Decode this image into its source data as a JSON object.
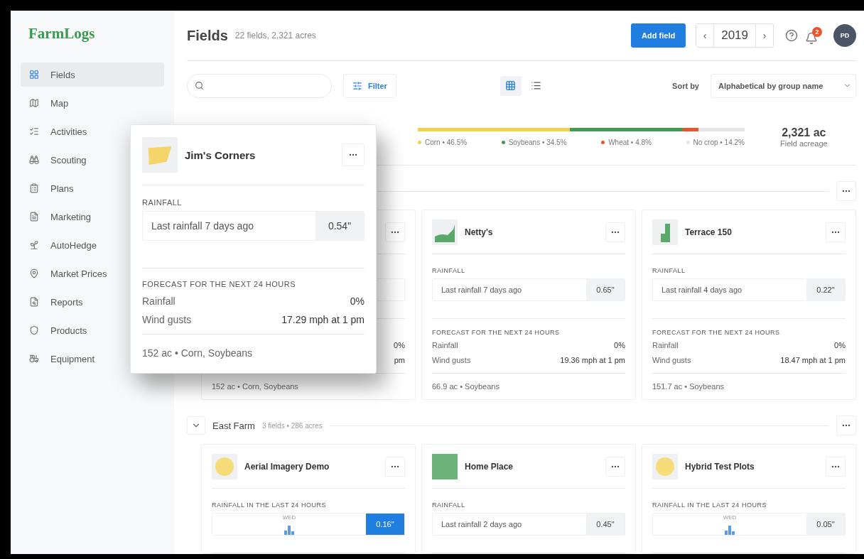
{
  "brand": "FarmLogs",
  "sidebar": {
    "items": [
      {
        "label": "Fields",
        "selected": true
      },
      {
        "label": "Map",
        "selected": false
      },
      {
        "label": "Activities",
        "selected": false
      },
      {
        "label": "Scouting",
        "selected": false
      },
      {
        "label": "Plans",
        "selected": false
      },
      {
        "label": "Marketing",
        "selected": false
      },
      {
        "label": "AutoHedge",
        "selected": false
      },
      {
        "label": "Market Prices",
        "selected": false
      },
      {
        "label": "Reports",
        "selected": false
      },
      {
        "label": "Products",
        "selected": false
      },
      {
        "label": "Equipment",
        "selected": false
      }
    ]
  },
  "header": {
    "title": "Fields",
    "subtitle": "22 fields, 2,321 acres",
    "add_button": "Add field",
    "year": "2019",
    "prev": "‹",
    "next": "›",
    "notifications": "2",
    "avatar": "PD"
  },
  "toolbar": {
    "filter": "Filter",
    "views": [
      {
        "kind": "grid",
        "selected": true
      },
      {
        "kind": "list",
        "selected": false
      }
    ],
    "sort_label": "Sort by",
    "sort_value": "Alphabetical by group name"
  },
  "summary": {
    "crops": [
      {
        "label": "Corn • 46.5%",
        "color": "#f2d04e"
      },
      {
        "label": "Soybeans • 34.5%",
        "color": "#3f9c52"
      },
      {
        "label": "Wheat • 4.8%",
        "color": "#e8552b"
      },
      {
        "label": "No crop • 14.2%",
        "color": "#e3e4e6"
      }
    ],
    "total": "2,321 ac",
    "total_label": "Field acreage"
  },
  "groups": [
    {
      "fields": [
        {
          "rain": "0%",
          "wind": "pm",
          "footer": "152 ac • Corn, Soybeans"
        },
        {
          "kind": "last_rainfall",
          "name": "Netty's",
          "thumb": {
            "kind": "slope",
            "color": "#5aa96b"
          },
          "section": "RAINFALL",
          "reading": "Last rainfall 7 days ago",
          "value": "0.65\"",
          "forecast_label": "FORECAST FOR THE NEXT 24 HOURS",
          "rain_label": "Rainfall",
          "rain": "0%",
          "wind_label": "Wind gusts",
          "wind": "19.36 mph at 1 pm",
          "footer": "66.9 ac • Soybeans"
        },
        {
          "kind": "last_rainfall",
          "name": "Terrace 150",
          "thumb": {
            "kind": "terrace",
            "color": "#5aa96b"
          },
          "section": "RAINFALL",
          "reading": "Last rainfall 4 days ago",
          "value": "0.22\"",
          "forecast_label": "FORECAST FOR THE NEXT 24 HOURS",
          "rain_label": "Rainfall",
          "rain": "0%",
          "wind_label": "Wind gusts",
          "wind": "18.47 mph at 1 pm",
          "footer": "151.7 ac • Soybeans"
        }
      ]
    },
    {
      "name": "East Farm",
      "summary": "3 fields • 286 acres",
      "expanded": true,
      "fields": [
        {
          "kind": "rainfall_24h",
          "name": "Aerial Imagery Demo",
          "thumb": {
            "kind": "circle",
            "color": "#f5dc78"
          },
          "section": "RAINFALL IN THE LAST 24 HOURS",
          "day": "WED",
          "value": "0.16\"",
          "highlighted": true
        },
        {
          "kind": "last_rainfall",
          "name": "Home Place",
          "thumb": {
            "kind": "square",
            "color": "#6db27a"
          },
          "section": "RAINFALL",
          "reading": "Last rainfall 2 days ago",
          "value": "0.45\"",
          "highlighted": false
        },
        {
          "kind": "rainfall_24h",
          "name": "Hybrid Test Plots",
          "thumb": {
            "kind": "circle",
            "color": "#f5dc78"
          },
          "section": "RAINFALL IN THE LAST 24 HOURS",
          "day": "WED",
          "value": "0.05\"",
          "highlighted": false
        }
      ]
    }
  ],
  "popover": {
    "name": "Jim's Corners",
    "thumb": {
      "kind": "blob",
      "color": "#f5d56a"
    },
    "section": "RAINFALL",
    "reading": "Last rainfall 7 days ago",
    "value": "0.54\"",
    "forecast_label": "FORECAST FOR THE NEXT 24 HOURS",
    "rain_label": "Rainfall",
    "rain": "0%",
    "wind_label": "Wind gusts",
    "wind": "17.29 mph at 1 pm",
    "footer": "152 ac • Corn, Soybeans"
  }
}
